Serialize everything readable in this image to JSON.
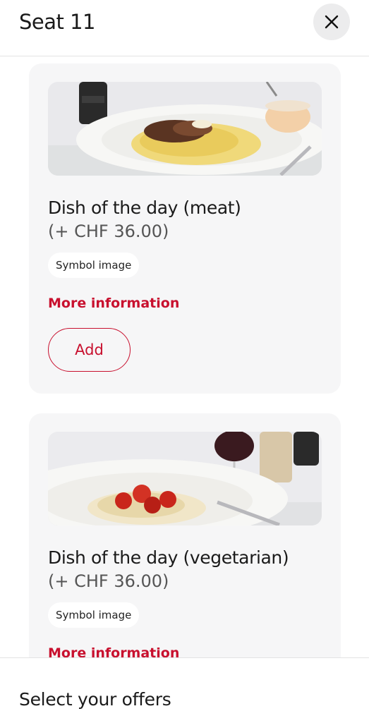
{
  "header": {
    "title": "Seat 11",
    "close_icon": "close-icon"
  },
  "dishes": [
    {
      "name": "Dish of the day (meat)",
      "price": "(+ CHF 36.00)",
      "badge": "Symbol image",
      "more_info": "More information",
      "add_label": "Add",
      "image": "pasta-with-bolognese"
    },
    {
      "name": "Dish of the day (vegetarian)",
      "price": "(+ CHF 36.00)",
      "badge": "Symbol image",
      "more_info": "More information",
      "image": "risotto-with-tomatoes"
    }
  ],
  "footer": {
    "text": "Select your offers"
  },
  "colors": {
    "accent": "#c8102e",
    "card": "#f6f6f7"
  }
}
